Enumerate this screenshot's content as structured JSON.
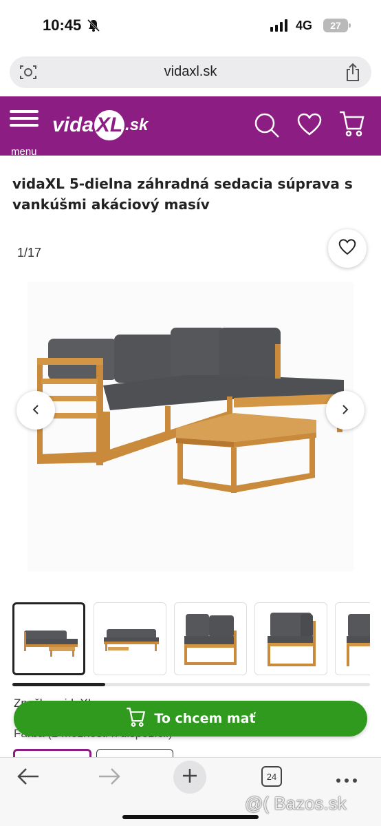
{
  "status_bar": {
    "time": "10:45",
    "network": "4G",
    "battery": "27"
  },
  "browser": {
    "url": "vidaxl.sk",
    "tab_count": "24"
  },
  "header": {
    "menu_label": "menu",
    "logo_parts": [
      "vida",
      "XL",
      ".sk"
    ],
    "brand_color": "#8c1d82",
    "icons": [
      "search-icon",
      "heart-icon",
      "cart-icon"
    ]
  },
  "product": {
    "title": "vidaXL 5-dielna záhradná sedacia súprava s vankúšmi akáciový masív",
    "image_counter": "1/17",
    "thumbnail_count_visible": 5,
    "brand_line": "Značka: vidaXL",
    "color_line": "Farba (2 možnosti k dispozícii)"
  },
  "cta": {
    "label": "To chcem mať",
    "color": "#2f9a1e"
  },
  "watermark": "@( Bazos.sk"
}
